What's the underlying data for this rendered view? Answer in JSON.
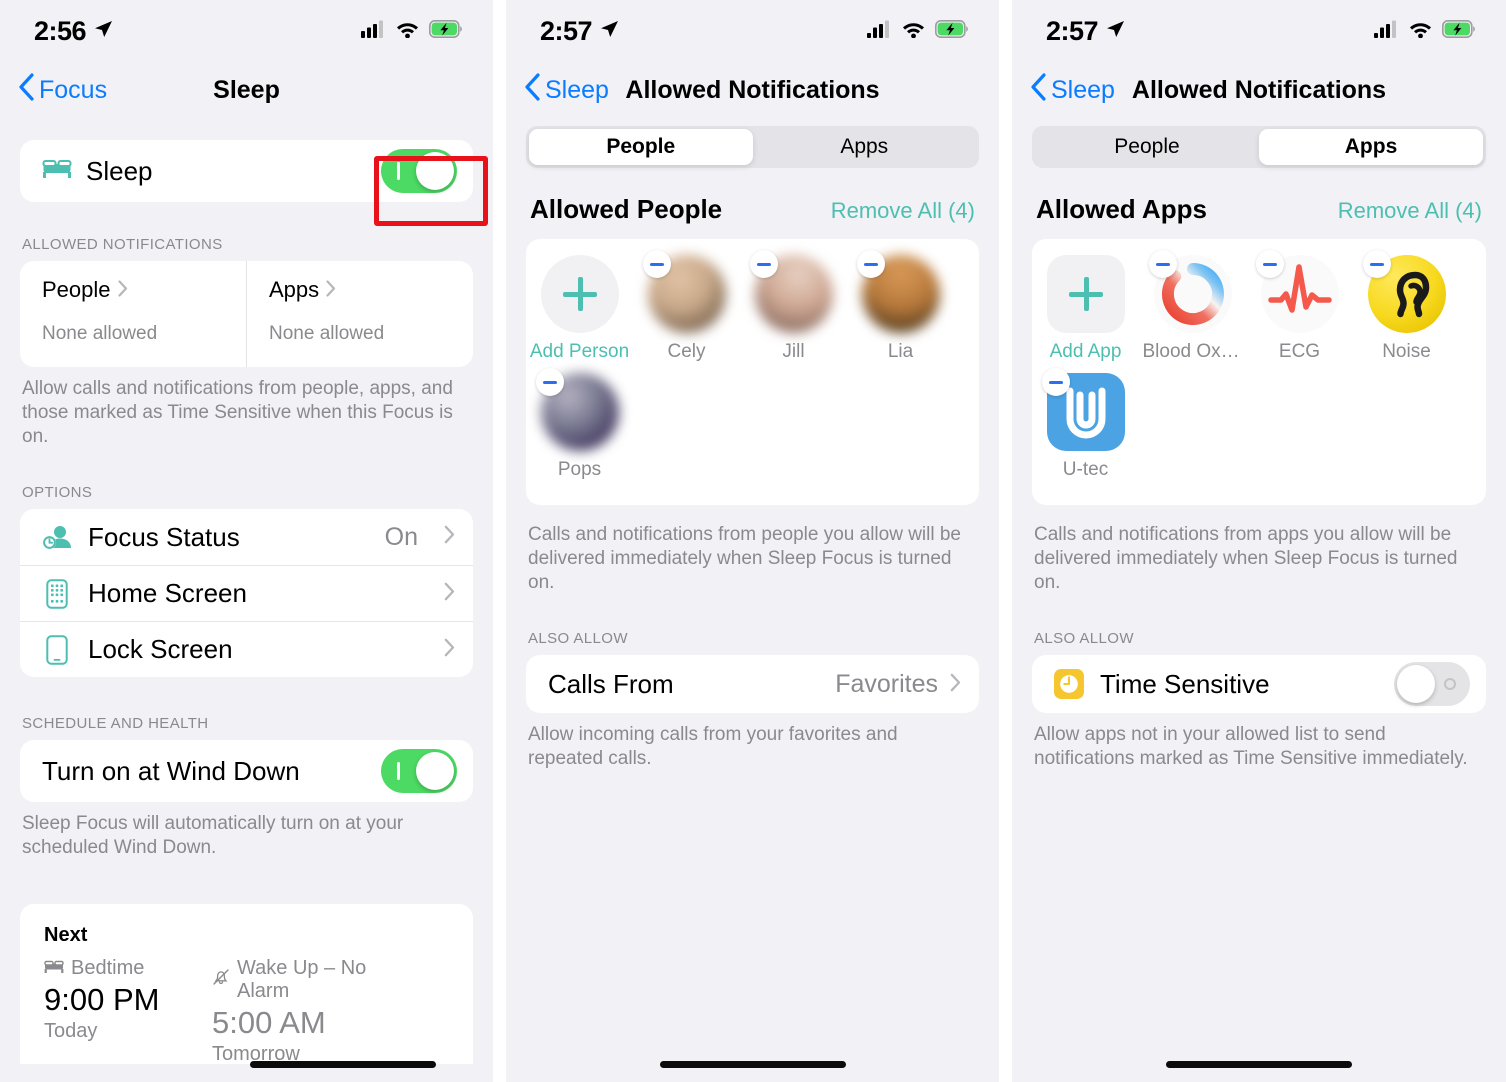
{
  "colors": {
    "accent_blue": "#0a7cff",
    "accent_teal": "#4cbfb0",
    "toggle_on_green": "#4cd964",
    "highlight_red": "#e8131a",
    "page_bg": "#f2f1f6",
    "card_bg": "#ffffff",
    "secondary_text": "#8a8a8e"
  },
  "screen1": {
    "statusbar": {
      "time": "2:56",
      "location_icon": "location-arrow-icon",
      "signal_icon": "cellular-signal-icon",
      "wifi_icon": "wifi-icon",
      "battery_icon": "battery-charging-icon"
    },
    "nav": {
      "back_label": "Focus",
      "title": "Sleep"
    },
    "sleep_row": {
      "icon": "bed-icon",
      "label": "Sleep",
      "toggle_state": "on"
    },
    "allowed_section": {
      "header": "ALLOWED NOTIFICATIONS",
      "people": {
        "title": "People",
        "value": "None allowed"
      },
      "apps": {
        "title": "Apps",
        "value": "None allowed"
      },
      "footnote": "Allow calls and notifications from people, apps, and those marked as Time Sensitive when this Focus is on."
    },
    "options_section": {
      "header": "OPTIONS",
      "rows": [
        {
          "icon": "focus-status-icon",
          "label": "Focus Status",
          "value": "On"
        },
        {
          "icon": "home-screen-icon",
          "label": "Home Screen",
          "value": ""
        },
        {
          "icon": "lock-screen-icon",
          "label": "Lock Screen",
          "value": ""
        }
      ]
    },
    "schedule_section": {
      "header": "SCHEDULE AND HEALTH",
      "wind_down": {
        "label": "Turn on at Wind Down",
        "toggle_state": "on"
      },
      "footnote": "Sleep Focus will automatically turn on at your scheduled Wind Down."
    },
    "next_card": {
      "title": "Next",
      "bedtime": {
        "icon": "bed-icon",
        "label": "Bedtime",
        "time": "9:00 PM",
        "day": "Today"
      },
      "wakeup": {
        "icon": "bell-slash-icon",
        "label": "Wake Up – No Alarm",
        "time": "5:00 AM",
        "day": "Tomorrow"
      }
    }
  },
  "screen2": {
    "statusbar": {
      "time": "2:57",
      "location_icon": "location-arrow-icon",
      "signal_icon": "cellular-signal-icon",
      "wifi_icon": "wifi-icon",
      "battery_icon": "battery-charging-icon"
    },
    "nav": {
      "back_label": "Sleep",
      "title": "Allowed Notifications"
    },
    "segmented": {
      "options": [
        "People",
        "Apps"
      ],
      "selected": "People"
    },
    "allowed_header": {
      "title": "Allowed People",
      "remove_all": "Remove All (4)"
    },
    "people": [
      {
        "name": "Add Person",
        "type": "add",
        "shape": "circle"
      },
      {
        "name": "Cely",
        "type": "avatar",
        "c1": "#c9a98a",
        "c2": "#7b6550",
        "c3": "#e3c4a6"
      },
      {
        "name": "Jill",
        "type": "avatar",
        "c1": "#cfa894",
        "c2": "#8d6f62",
        "c3": "#e8d2c4"
      },
      {
        "name": "Lia",
        "type": "avatar",
        "c1": "#b87a3c",
        "c2": "#3a2a1c",
        "c3": "#d99a57"
      },
      {
        "name": "Pops",
        "type": "avatar",
        "c1": "#7a7b92",
        "c2": "#4b4267",
        "c3": "#9c9ab2"
      }
    ],
    "grid_footnote": "Calls and notifications from people you allow will be delivered immediately when Sleep Focus is turned on.",
    "also_allow": {
      "header": "ALSO ALLOW",
      "calls_from": {
        "label": "Calls From",
        "value": "Favorites"
      },
      "footnote": "Allow incoming calls from your favorites and repeated calls."
    }
  },
  "screen3": {
    "statusbar": {
      "time": "2:57",
      "location_icon": "location-arrow-icon",
      "signal_icon": "cellular-signal-icon",
      "wifi_icon": "wifi-icon",
      "battery_icon": "battery-charging-icon"
    },
    "nav": {
      "back_label": "Sleep",
      "title": "Allowed Notifications"
    },
    "segmented": {
      "options": [
        "People",
        "Apps"
      ],
      "selected": "Apps"
    },
    "allowed_header": {
      "title": "Allowed Apps",
      "remove_all": "Remove All (4)"
    },
    "apps": [
      {
        "name": "Add App",
        "icon": "add-app-icon"
      },
      {
        "name": "Blood Oxyg...",
        "icon": "blood-oxygen-icon"
      },
      {
        "name": "ECG",
        "icon": "ecg-icon"
      },
      {
        "name": "Noise",
        "icon": "noise-icon"
      },
      {
        "name": "U-tec",
        "icon": "utec-icon"
      }
    ],
    "grid_footnote": "Calls and notifications from apps you allow will be delivered immediately when Sleep Focus is turned on.",
    "also_allow": {
      "header": "ALSO ALLOW",
      "time_sensitive": {
        "icon": "clock-icon",
        "label": "Time Sensitive",
        "toggle_state": "off"
      },
      "footnote": "Allow apps not in your allowed list to send notifications marked as Time Sensitive immediately."
    }
  }
}
